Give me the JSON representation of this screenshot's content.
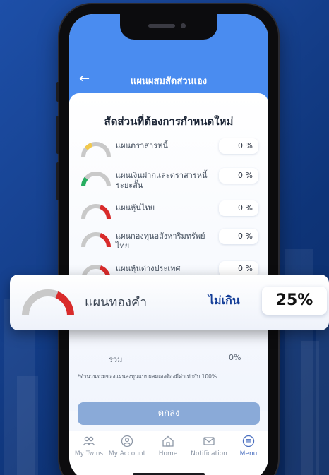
{
  "header": {
    "title": "แผนผสมสัดส่วนเอง"
  },
  "section_title": "สัดส่วนที่ต้องการกำหนดใหม่",
  "plans": [
    {
      "label": "แผนตราสารหนี้",
      "value": "0 %",
      "accent": "#f2c94c"
    },
    {
      "label": "แผนเงินฝากและตราสารหนี้ระยะสั้น",
      "value": "0 %",
      "accent": "#27ae60"
    },
    {
      "label": "แผนหุ้นไทย",
      "value": "0 %",
      "accent": "#d92b2b"
    },
    {
      "label": "แผนกองทุนอสังหาริมทรัพย์ไทย",
      "value": "0 %",
      "accent": "#d92b2b"
    },
    {
      "label": "แผนหุ้นต่างประเทศ",
      "value": "0 %",
      "accent": "#d92b2b"
    }
  ],
  "total": {
    "label": "รวม",
    "value": "0%"
  },
  "footnote": "*จำนวนรวมของแผนลงทุนแบบผสมเองต้องมีค่าเท่ากับ 100%",
  "confirm_label": "ตกลง",
  "nav": [
    {
      "label": "My Twins",
      "icon": "people-icon",
      "active": false
    },
    {
      "label": "My Account",
      "icon": "account-icon",
      "active": false
    },
    {
      "label": "Home",
      "icon": "home-icon",
      "active": false
    },
    {
      "label": "Notification",
      "icon": "mail-icon",
      "active": false
    },
    {
      "label": "Menu",
      "icon": "menu-icon",
      "active": true
    }
  ],
  "overlay": {
    "label": "แผนทองคำ",
    "limit_text": "ไม่เกิน",
    "value": "25%",
    "accent": "#d92b2b"
  },
  "colors": {
    "header": "#4a8cf0",
    "button": "#8aaad8",
    "limit_text": "#143e98",
    "gauge_track": "#c9c9c9"
  }
}
